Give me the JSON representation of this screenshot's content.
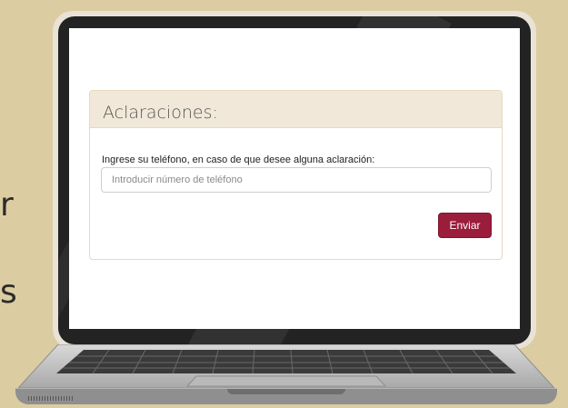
{
  "background_text": {
    "letter_1": "r",
    "letter_2": "s"
  },
  "form": {
    "title": "Aclaraciones:",
    "label": "Ingrese su teléfono, en caso de que desee alguna aclaración:",
    "phone_placeholder": "Introducir número de teléfono",
    "phone_value": "",
    "submit_label": "Enviar"
  },
  "colors": {
    "background": "#dccca1",
    "panel_heading": "#f1e8d9",
    "panel_border": "#ead8bd",
    "button": "#9a1d3b",
    "bezel": "#232323"
  }
}
